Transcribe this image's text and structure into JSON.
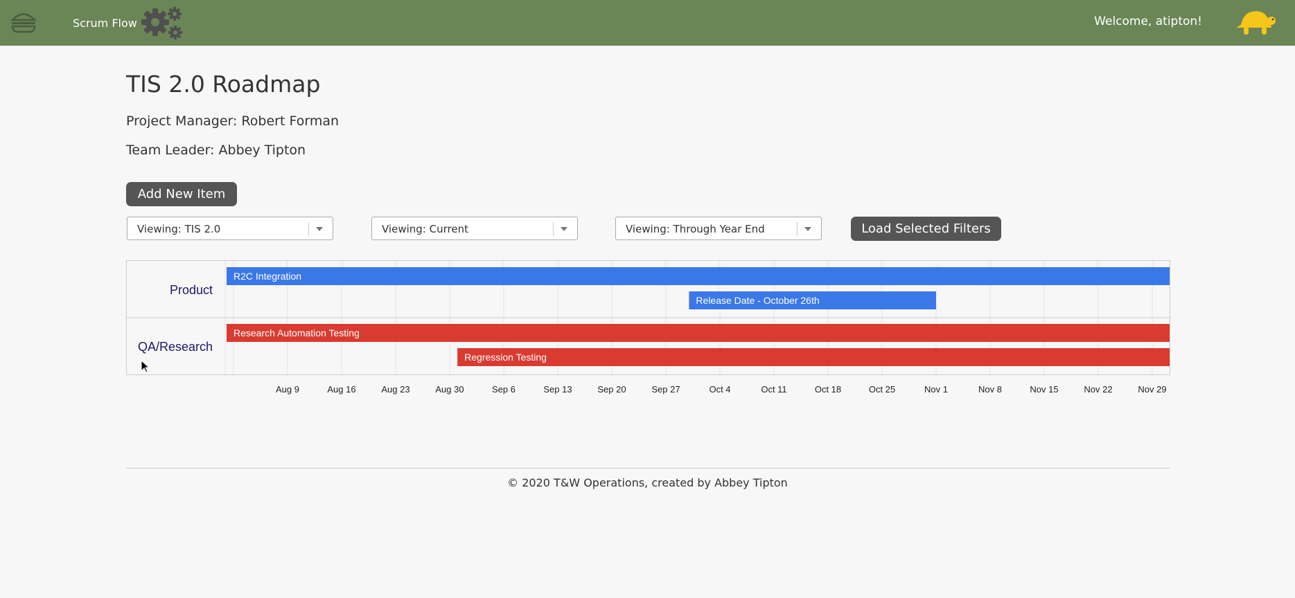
{
  "header": {
    "brand": "Scrum Flow",
    "welcome": "Welcome, atipton!",
    "menu_icon": "hamburger-icon",
    "logo_icon": "gears-icon",
    "avatar_icon": "turtle-icon",
    "bar_color": "#6a8556",
    "avatar_color": "#f5c518"
  },
  "page": {
    "title": "TIS 2.0 Roadmap",
    "project_manager": "Project Manager: Robert Forman",
    "team_leader": "Team Leader: Abbey Tipton",
    "add_button": "Add New Item",
    "load_button": "Load Selected Filters"
  },
  "filters": [
    {
      "label": "Viewing: TIS 2.0"
    },
    {
      "label": "Viewing: Current"
    },
    {
      "label": "Viewing: Through Year End"
    }
  ],
  "chart_data": {
    "type": "timeline",
    "x_ticks": [
      "Aug 9",
      "Aug 16",
      "Aug 23",
      "Aug 30",
      "Sep 6",
      "Sep 13",
      "Sep 20",
      "Sep 27",
      "Oct 4",
      "Oct 11",
      "Oct 18",
      "Oct 25",
      "Nov 1",
      "Nov 8",
      "Nov 15",
      "Nov 22",
      "Nov 29"
    ],
    "x_range": [
      "2020-08-02",
      "2020-11-30"
    ],
    "rows": [
      {
        "label": "Product",
        "color": "#3b78e7",
        "tasks": [
          {
            "name": "R2C Integration",
            "start": "2020-08-02",
            "end": "2020-11-30"
          },
          {
            "name": "Release Date - October 26th",
            "start": "2020-09-30",
            "end": "2020-11-01"
          }
        ]
      },
      {
        "label": "QA/Research",
        "color": "#d93b30",
        "tasks": [
          {
            "name": "Research Automation Testing",
            "start": "2020-08-02",
            "end": "2020-11-30"
          },
          {
            "name": "Regression Testing",
            "start": "2020-08-31",
            "end": "2020-11-30"
          }
        ]
      }
    ]
  },
  "footer": {
    "text": "© 2020 T&W Operations, created by Abbey Tipton"
  }
}
